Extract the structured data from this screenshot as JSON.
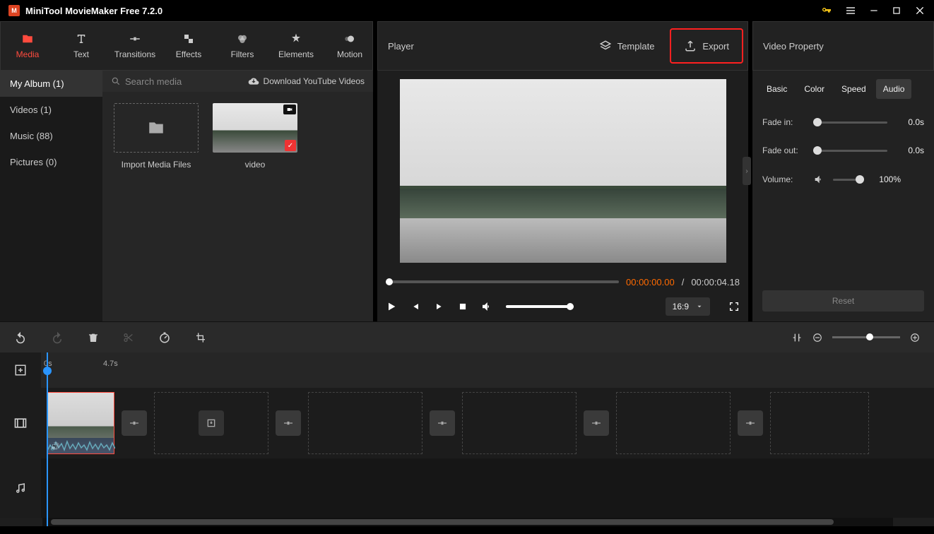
{
  "titlebar": {
    "title": "MiniTool MovieMaker Free 7.2.0"
  },
  "tabs": {
    "media": "Media",
    "text": "Text",
    "transitions": "Transitions",
    "effects": "Effects",
    "filters": "Filters",
    "elements": "Elements",
    "motion": "Motion"
  },
  "sidebar": {
    "album": "My Album (1)",
    "videos": "Videos (1)",
    "music": "Music (88)",
    "pictures": "Pictures (0)"
  },
  "media": {
    "search_placeholder": "Search media",
    "download": "Download YouTube Videos",
    "import_label": "Import Media Files",
    "video_label": "video"
  },
  "player": {
    "title": "Player",
    "template": "Template",
    "export": "Export",
    "time_current": "00:00:00.00",
    "time_sep": " / ",
    "time_total": "00:00:04.18",
    "aspect": "16:9"
  },
  "props": {
    "title": "Video Property",
    "tabs": {
      "basic": "Basic",
      "color": "Color",
      "speed": "Speed",
      "audio": "Audio"
    },
    "fade_in_label": "Fade in:",
    "fade_in_val": "0.0s",
    "fade_out_label": "Fade out:",
    "fade_out_val": "0.0s",
    "volume_label": "Volume:",
    "volume_val": "100%",
    "reset": "Reset"
  },
  "timeline": {
    "mark0": "0s",
    "mark1": "4.7s"
  }
}
